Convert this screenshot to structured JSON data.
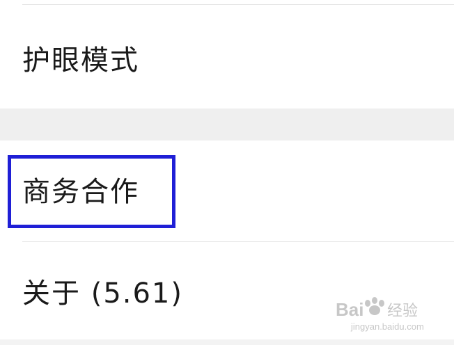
{
  "settings_list": {
    "items": [
      {
        "label": "护眼模式"
      },
      {
        "label": "商务合作"
      },
      {
        "label": "关于 (5.61)"
      }
    ]
  },
  "highlight": {
    "color": "#1f1fd6",
    "target": "商务合作"
  },
  "colors": {
    "background": "#ffffff",
    "section_gap": "#efefef",
    "divider": "#e6e6e6",
    "text": "#1a1a1a"
  },
  "watermark": {
    "brand": "Bai度经验",
    "url": "jingyan.baidu.com",
    "icon": "baidu-paw-icon"
  }
}
